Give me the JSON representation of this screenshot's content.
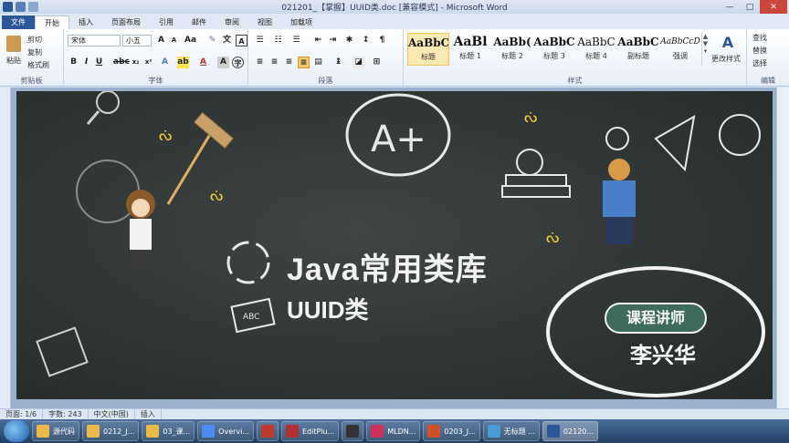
{
  "window": {
    "title": "021201_【掌握】UUID类.doc [兼容模式] - Microsoft Word",
    "controls": [
      "—",
      "□",
      "✕"
    ]
  },
  "tabs": [
    "文件",
    "开始",
    "插入",
    "页面布局",
    "引用",
    "邮件",
    "审阅",
    "视图",
    "加载项"
  ],
  "clipboard": {
    "paste": "粘贴",
    "cut": "剪切",
    "copy": "复制",
    "format_painter": "格式刷",
    "label": "剪贴板"
  },
  "font": {
    "family": "宋体",
    "size": "小五",
    "label": "字体"
  },
  "paragraph": {
    "label": "段落"
  },
  "styles": {
    "label": "样式",
    "items": [
      {
        "sample": "AaBbC",
        "name": "标题"
      },
      {
        "sample": "AaBl",
        "name": "标题 1"
      },
      {
        "sample": "AaBb(",
        "name": "标题 2"
      },
      {
        "sample": "AaBbC",
        "name": "标题 3"
      },
      {
        "sample": "AaBbC",
        "name": "标题 4"
      },
      {
        "sample": "AaBbC",
        "name": "副标题"
      },
      {
        "sample": "AaBbCcD",
        "name": "强调"
      }
    ],
    "change_styles": "更改样式"
  },
  "editing": {
    "find": "查找",
    "replace": "替换",
    "select": "选择",
    "label": "编辑"
  },
  "slide": {
    "title": "Java常用类库",
    "subtitle": "UUID类",
    "teacher_label": "课程讲师",
    "teacher_name": "李兴华",
    "grade": "A+"
  },
  "statusbar": {
    "page": "页面: 1/6",
    "words": "字数: 243",
    "lang": "中文(中国)",
    "mode": "插入"
  },
  "taskbar": [
    {
      "label": "源代码",
      "color": "#e9b949"
    },
    {
      "label": "0212_J...",
      "color": "#e9b949"
    },
    {
      "label": "03_课...",
      "color": "#e9b949"
    },
    {
      "label": "Overvi...",
      "color": "#4c8bf5"
    },
    {
      "label": "",
      "color": "#c0392b"
    },
    {
      "label": "EditPlu...",
      "color": "#b03030"
    },
    {
      "label": "",
      "color": "#333333"
    },
    {
      "label": "MLDN...",
      "color": "#d0305a"
    },
    {
      "label": "0203_J...",
      "color": "#d2502a"
    },
    {
      "label": "无标题 ...",
      "color": "#4a9bd1"
    },
    {
      "label": "02120...",
      "color": "#2b5797"
    }
  ]
}
